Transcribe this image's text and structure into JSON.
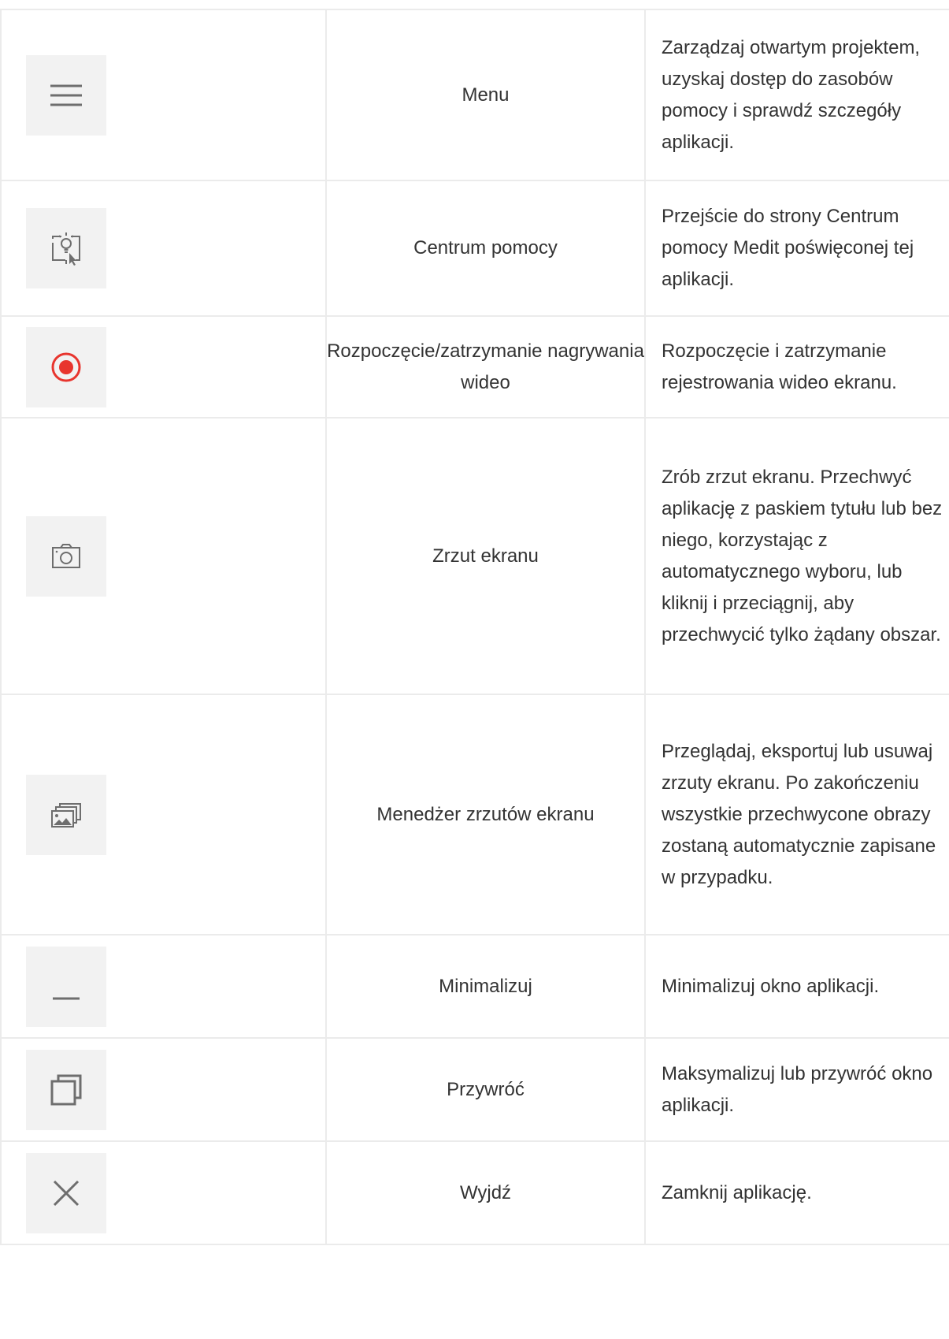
{
  "rows": [
    {
      "icon": "hamburger-menu-icon",
      "name": "Menu",
      "description": "Zarządzaj otwartym projektem, uzyskaj dostęp do zasobów pomocy i sprawdź szczegóły aplikacji."
    },
    {
      "icon": "help-center-icon",
      "name": "Centrum pomocy",
      "description": "Przejście do strony Centrum pomocy Medit poświęconej tej aplikacji."
    },
    {
      "icon": "record-icon",
      "name": "Rozpoczęcie/zatrzymanie nagrywania wideo",
      "description": "Rozpoczęcie i zatrzymanie rejestrowania wideo ekranu."
    },
    {
      "icon": "camera-icon",
      "name": "Zrzut ekranu",
      "description": "Zrób zrzut ekranu. Przechwyć aplikację z paskiem tytułu lub bez niego, korzystając z automatycznego wyboru, lub kliknij i przeciągnij, aby przechwycić tylko żądany obszar."
    },
    {
      "icon": "screenshot-manager-icon",
      "name": "Menedżer zrzutów ekranu",
      "description": "Przeglądaj, eksportuj lub usuwaj zrzuty ekranu. Po zakończeniu wszystkie przechwycone obrazy zostaną automatycznie zapisane w przypadku."
    },
    {
      "icon": "minimize-icon",
      "name": "Minimalizuj",
      "description": "Minimalizuj okno aplikacji."
    },
    {
      "icon": "restore-icon",
      "name": "Przywróć",
      "description": "Maksymalizuj lub przywróć okno aplikacji."
    },
    {
      "icon": "close-icon",
      "name": "Wyjdź",
      "description": "Zamknij aplikację."
    }
  ],
  "colors": {
    "border": "#ebebeb",
    "icon_background": "#f2f2f2",
    "icon_stroke": "#6e6e6e",
    "record_red": "#e8352e",
    "text": "#333333"
  }
}
